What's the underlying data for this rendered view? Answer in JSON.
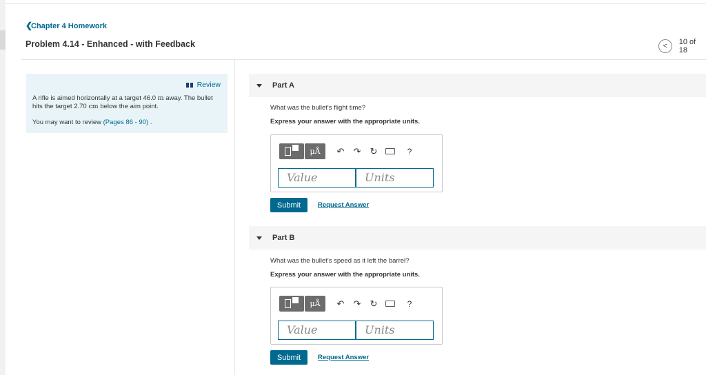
{
  "breadcrumb": {
    "label": "Chapter 4 Homework"
  },
  "problem": {
    "title": "Problem 4.14 - Enhanced - with Feedback"
  },
  "pager": {
    "count": "10 of 18"
  },
  "info": {
    "review_label": "Review",
    "text_part1": "A rifle is aimed horizontally at a target 46.0 ",
    "unit_m": "m",
    "text_part2": " away. The bullet hits the target 2.70 ",
    "unit_cm": "cm",
    "text_part3": " below the aim point.",
    "review_prefix": "You may want to review ",
    "pages_link": "(Pages 86 - 90)",
    "review_suffix": " ."
  },
  "parts": [
    {
      "label": "Part A",
      "question": "What was the bullet's flight time?",
      "instruction": "Express your answer with the appropriate units.",
      "value_placeholder": "Value",
      "units_placeholder": "Units",
      "submit_label": "Submit",
      "request_label": "Request Answer"
    },
    {
      "label": "Part B",
      "question": "What was the bullet's speed as it left the barrel?",
      "instruction": "Express your answer with the appropriate units.",
      "value_placeholder": "Value",
      "units_placeholder": "Units",
      "submit_label": "Submit",
      "request_label": "Request Answer"
    }
  ],
  "toolbar": {
    "mu_label": "μÅ",
    "undo_glyph": "↶",
    "redo_glyph": "↷",
    "reset_glyph": "↻",
    "help_label": "?"
  },
  "colors": {
    "accent": "#00698f",
    "info_bg": "#e8f4f8",
    "tool_bg": "#6c6c6c"
  }
}
